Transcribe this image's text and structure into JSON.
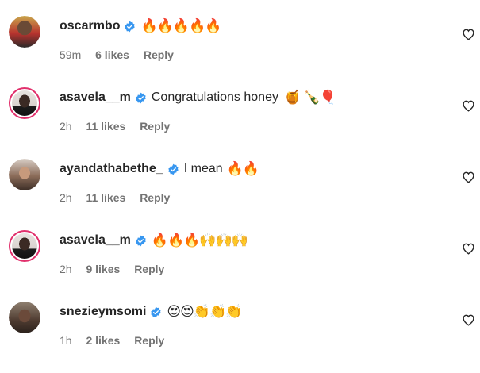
{
  "comments": [
    {
      "username": "oscarmbo",
      "verified": true,
      "text": "",
      "emoji": "🔥🔥🔥🔥🔥",
      "time": "59m",
      "likes": "6 likes",
      "reply": "Reply",
      "has_story_ring": false
    },
    {
      "username": "asavela__m",
      "verified": true,
      "text": "Congratulations honey",
      "emoji": "🍯 🍾🎈",
      "time": "2h",
      "likes": "11 likes",
      "reply": "Reply",
      "has_story_ring": true
    },
    {
      "username": "ayandathabethe_",
      "verified": true,
      "text": "I mean",
      "emoji": "🔥🔥",
      "time": "2h",
      "likes": "11 likes",
      "reply": "Reply",
      "has_story_ring": false
    },
    {
      "username": "asavela__m",
      "verified": true,
      "text": "",
      "emoji": "🔥🔥🔥🙌🙌🙌",
      "time": "2h",
      "likes": "9 likes",
      "reply": "Reply",
      "has_story_ring": true
    },
    {
      "username": "snezieymsomi",
      "verified": true,
      "text": "",
      "emoji": "😍😍👏👏👏",
      "time": "1h",
      "likes": "2 likes",
      "reply": "Reply",
      "has_story_ring": false
    }
  ],
  "colors": {
    "verified": "#3897f0",
    "story_ring": "#e1306c",
    "meta_text": "#737373"
  },
  "icons": {
    "like": "heart-outline-icon",
    "verified": "verified-badge-icon"
  }
}
